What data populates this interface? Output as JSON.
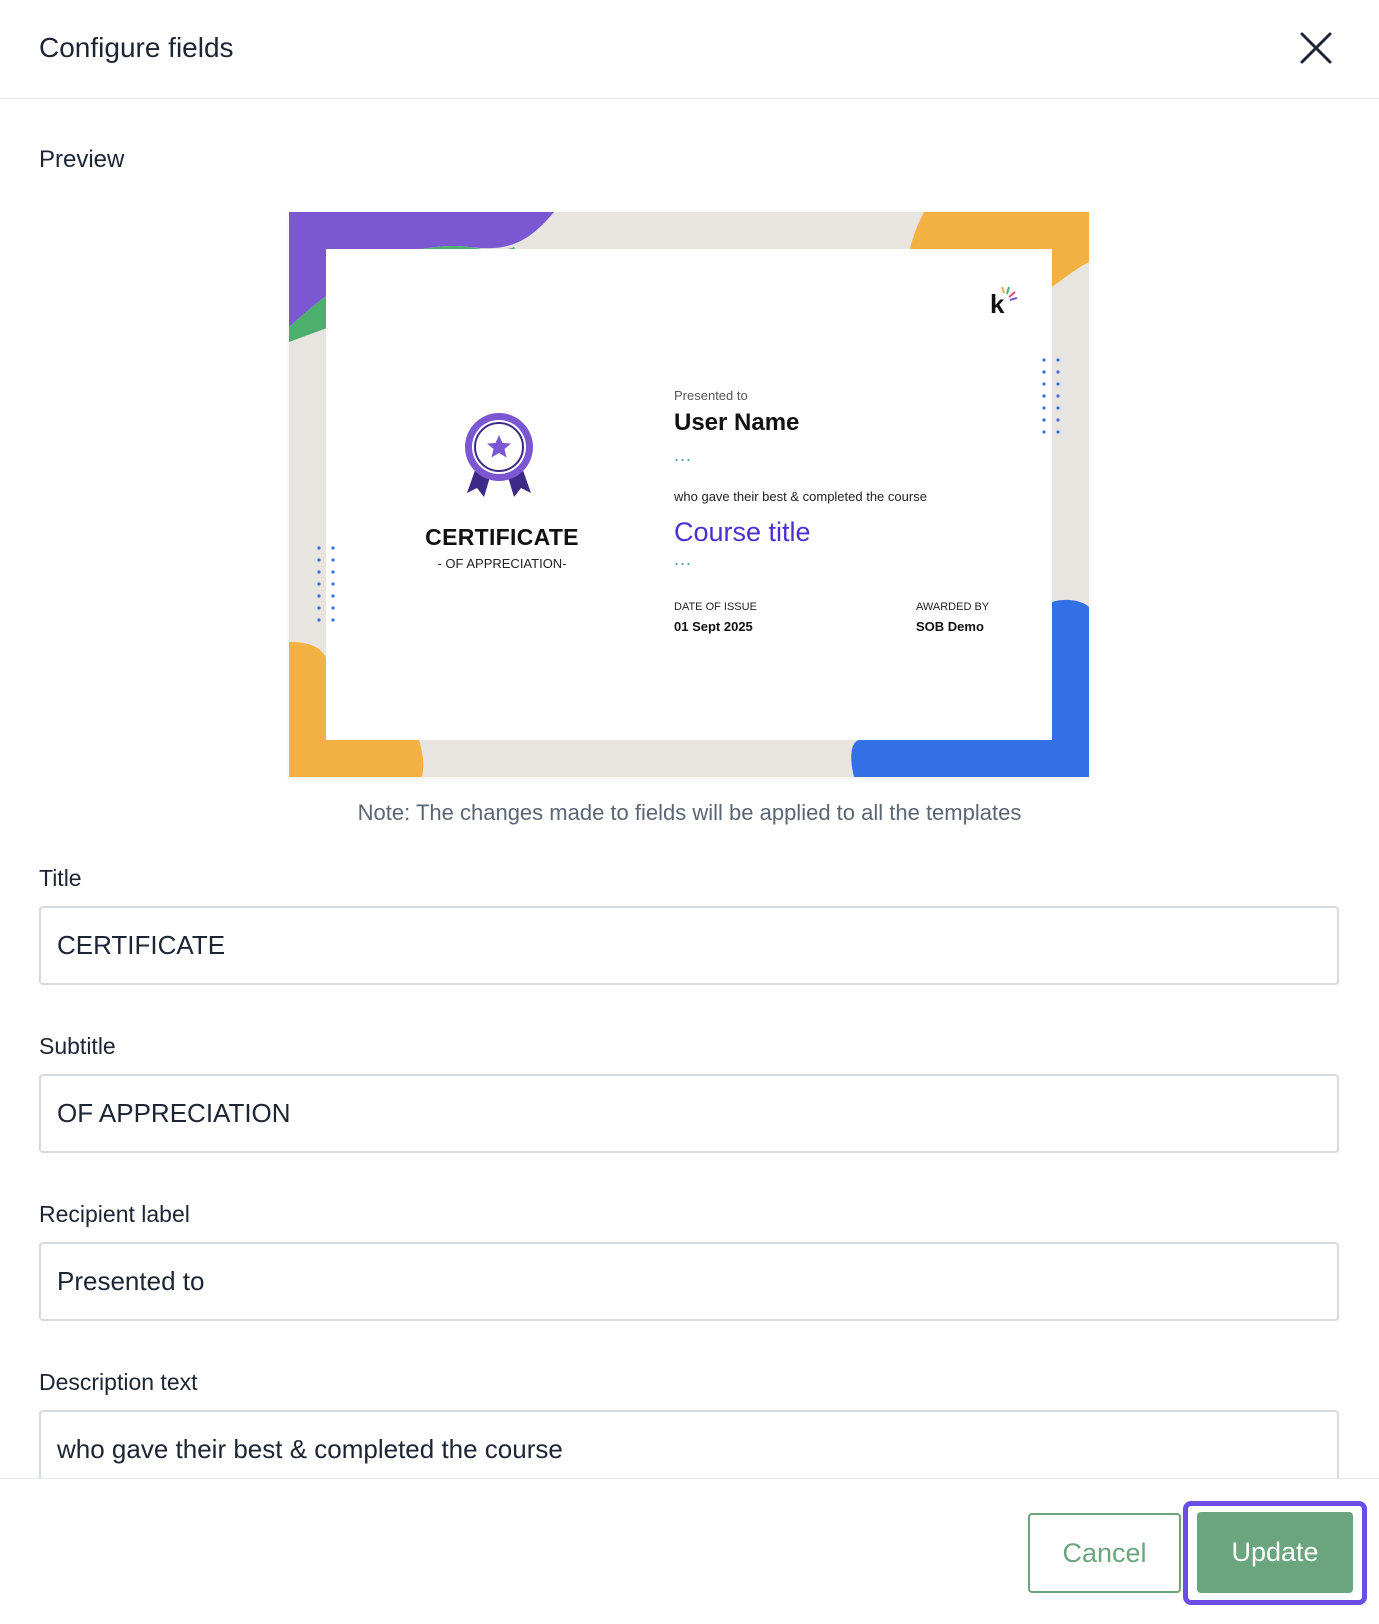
{
  "dialog": {
    "title": "Configure fields",
    "close_icon": "close-icon"
  },
  "preview": {
    "label": "Preview",
    "certificate": {
      "title": "CERTIFICATE",
      "subtitle": "- OF APPRECIATION-",
      "recipient_label": "Presented to",
      "recipient_name": "User Name",
      "dots": "...",
      "description": "who gave their best & completed the course",
      "course_title": "Course title",
      "date_label": "DATE OF ISSUE",
      "date_value": "01 Sept 2025",
      "awarded_label": "AWARDED BY",
      "awarded_value": "SOB Demo",
      "colors": {
        "purple": "#7b57d1",
        "green": "#4caf6e",
        "orange": "#f2b142",
        "blue": "#3370e6",
        "frame": "#e8e4e0"
      }
    }
  },
  "note": "Note: The changes made to fields will be applied to all the templates",
  "fields": {
    "title": {
      "label": "Title",
      "value": "CERTIFICATE"
    },
    "subtitle": {
      "label": "Subtitle",
      "value": "OF APPRECIATION"
    },
    "recipient_label": {
      "label": "Recipient label",
      "value": "Presented to"
    },
    "description": {
      "label": "Description text",
      "value": "who gave their best & completed the course"
    }
  },
  "footer": {
    "cancel_label": "Cancel",
    "update_label": "Update",
    "accent": "#6aa57e",
    "focus_color": "#6b4ee6"
  }
}
